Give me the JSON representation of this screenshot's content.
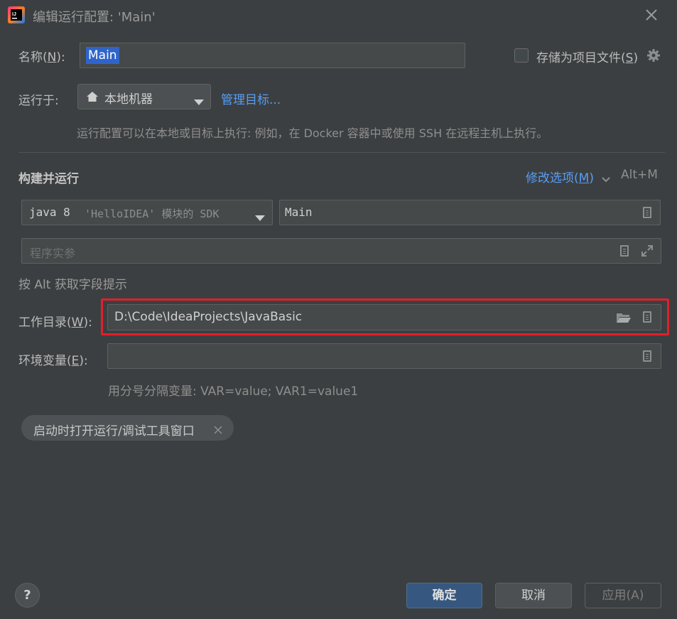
{
  "title": {
    "text": "编辑运行配置: 'Main'"
  },
  "name_row": {
    "label_prefix": "名称(",
    "label_mnemonic": "N",
    "label_suffix": "):",
    "value": "Main",
    "store_prefix": "存储为项目文件(",
    "store_mnemonic": "S",
    "store_suffix": ")"
  },
  "run_on": {
    "label": "运行于:",
    "selected": "本地机器",
    "manage_link": "管理目标...",
    "hint": "运行配置可以在本地或目标上执行: 例如，在 Docker 容器中或使用 SSH 在远程主机上执行。"
  },
  "build": {
    "section_title": "构建并运行",
    "modify_prefix": "修改选项(",
    "modify_mnemonic": "M",
    "modify_suffix": ")",
    "modify_shortcut": "Alt+M",
    "sdk_main": "java 8",
    "sdk_detail": "'HelloIDEA' 模块的 SDK",
    "main_class": "Main",
    "program_args_placeholder": "程序实参",
    "alt_hint": "按 Alt 获取字段提示"
  },
  "workdir": {
    "label_prefix": "工作目录(",
    "label_mnemonic": "W",
    "label_suffix": "):",
    "value": "D:\\Code\\IdeaProjects\\JavaBasic"
  },
  "env": {
    "label_prefix": "环境变量(",
    "label_mnemonic": "E",
    "label_suffix": "):",
    "value": "",
    "hint": "用分号分隔变量: VAR=value; VAR1=value1"
  },
  "chip": {
    "label": "启动时打开运行/调试工具窗口"
  },
  "footer": {
    "help": "?",
    "ok": "确定",
    "cancel": "取消",
    "apply": "应用(A)"
  },
  "colors": {
    "background": "#3c3f41",
    "field": "#45494a",
    "link": "#589df6",
    "primary_button": "#365880",
    "highlight_border": "#e0202a"
  }
}
